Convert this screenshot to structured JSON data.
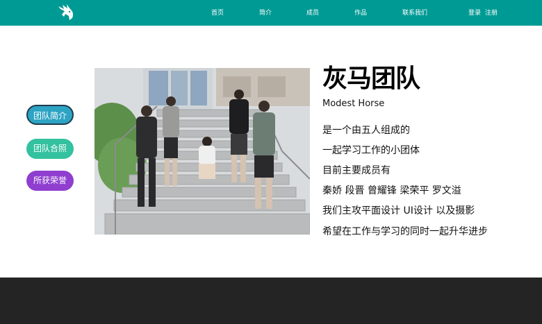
{
  "nav": {
    "items": [
      "首页",
      "简介",
      "成员",
      "作品",
      "联系我们"
    ],
    "login": "登录",
    "register": "注册"
  },
  "sidebar": {
    "buttons": [
      {
        "label": "团队简介",
        "color": "#2ea4c4",
        "active": true
      },
      {
        "label": "团队合照",
        "color": "#33c1a0",
        "active": false
      },
      {
        "label": "所获荣誉",
        "color": "#8f3ed0",
        "active": false
      }
    ]
  },
  "team": {
    "title": "灰马团队",
    "subtitle": "Modest Horse",
    "lines": [
      "是一个由五人组成的",
      "一起学习工作的小团体",
      "目前主要成员有",
      "秦娇 段晋 曾耀锋 梁荣平 罗文溢",
      "我们主攻平面设计 UI设计 以及摄影",
      "希望在工作与学习的同时一起升华进步"
    ]
  },
  "colors": {
    "topbar": "#009a94",
    "footer": "#242424"
  }
}
